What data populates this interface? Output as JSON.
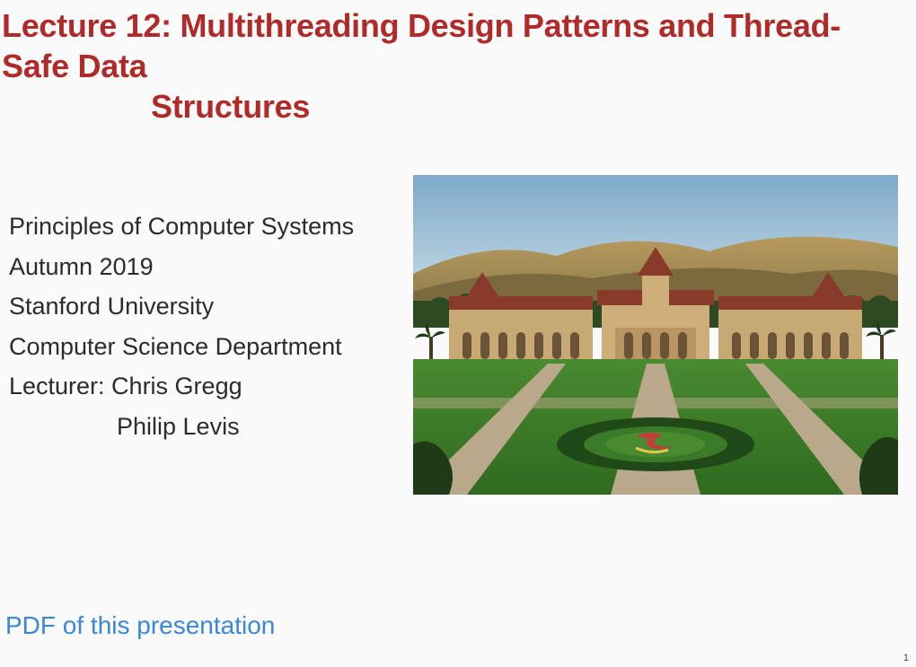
{
  "title_line1": "Lecture 12: Multithreading Design Patterns and Thread-Safe Data",
  "title_line2": "Structures",
  "info": {
    "course": "Principles of Computer Systems",
    "term": "Autumn 2019",
    "university": "Stanford University",
    "department": "Computer Science Department",
    "lecturer_label": "Lecturer: Chris Gregg",
    "lecturer2": "Philip Levis"
  },
  "pdf_link_text": "PDF of this presentation",
  "page_number": "1",
  "image_alt": "Stanford University campus photo"
}
